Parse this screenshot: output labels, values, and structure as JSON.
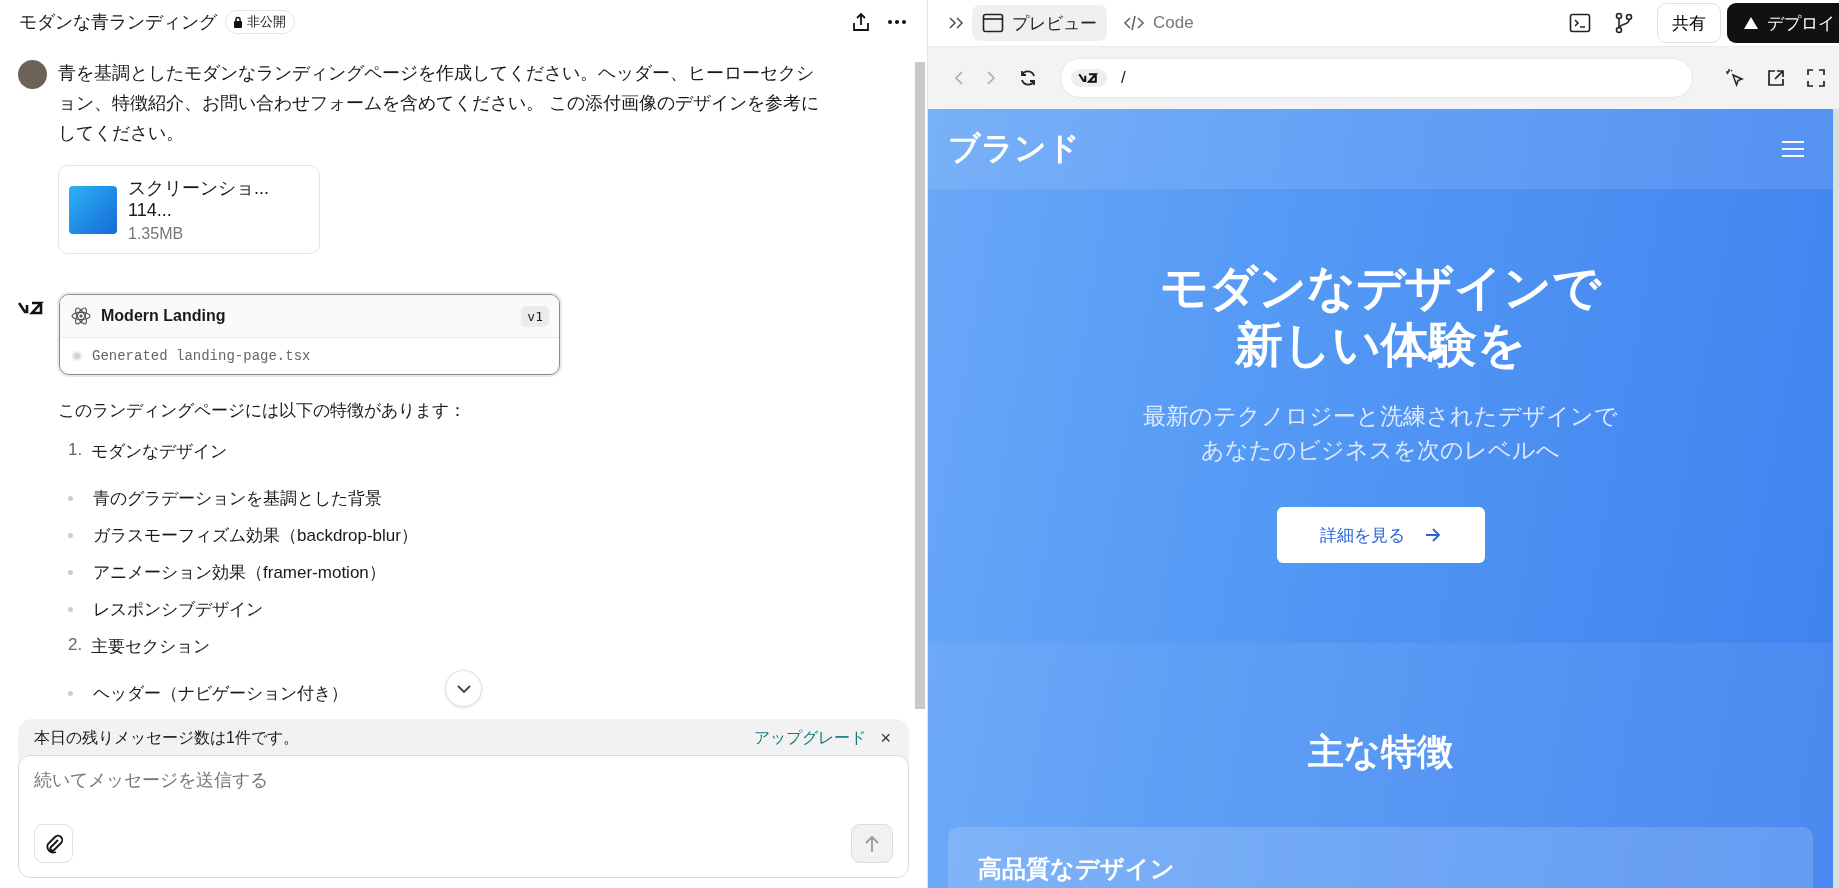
{
  "chat": {
    "title": "モダンな青ランディング",
    "visibility": "非公開"
  },
  "user_message": {
    "text": "青を基調としたモダンなランディングページを作成してください。ヘッダー、ヒーローセクション、特徴紹介、お問い合わせフォームを含めてください。 この添付画像のデザインを参考にしてください。",
    "attachment": {
      "name": "スクリーンショ... 114...",
      "size": "1.35MB"
    }
  },
  "artifact": {
    "title": "Modern Landing",
    "version": "v1",
    "status": "Generated landing-page.tsx"
  },
  "reply": {
    "intro": "このランディングページには以下の特徴があります：",
    "sections": [
      {
        "number": "1.",
        "title": "モダンなデザイン",
        "bullets": [
          "青のグラデーションを基調とした背景",
          "ガラスモーフィズム効果（backdrop-blur）",
          "アニメーション効果（framer-motion）",
          "レスポンシブデザイン"
        ]
      },
      {
        "number": "2.",
        "title": "主要セクション",
        "bullets": [
          "ヘッダー（ナビゲーション付き）"
        ]
      }
    ]
  },
  "notice": {
    "text": "本日の残りメッセージ数は1件です。",
    "link": "アップグレード",
    "close": "×"
  },
  "composer": {
    "placeholder": "続いてメッセージを送信する"
  },
  "toolbar": {
    "tabs": [
      {
        "label": "プレビュー",
        "kind": "preview",
        "selected": true
      },
      {
        "label": "Code",
        "kind": "code",
        "selected": false
      }
    ],
    "share": "共有",
    "deploy": "デプロイ"
  },
  "address_bar": {
    "path": "/"
  },
  "preview": {
    "brand": "ブランド",
    "hero_title": [
      "モダンなデザインで",
      "新しい体験を"
    ],
    "hero_subtitle": [
      "最新のテクノロジーと洗練されたデザインで",
      "あなたのビジネスを次のレベルへ"
    ],
    "cta": "詳細を見る",
    "features_title": "主な特徴",
    "feature_cards": [
      {
        "title": "高品質なデザイン"
      }
    ]
  }
}
